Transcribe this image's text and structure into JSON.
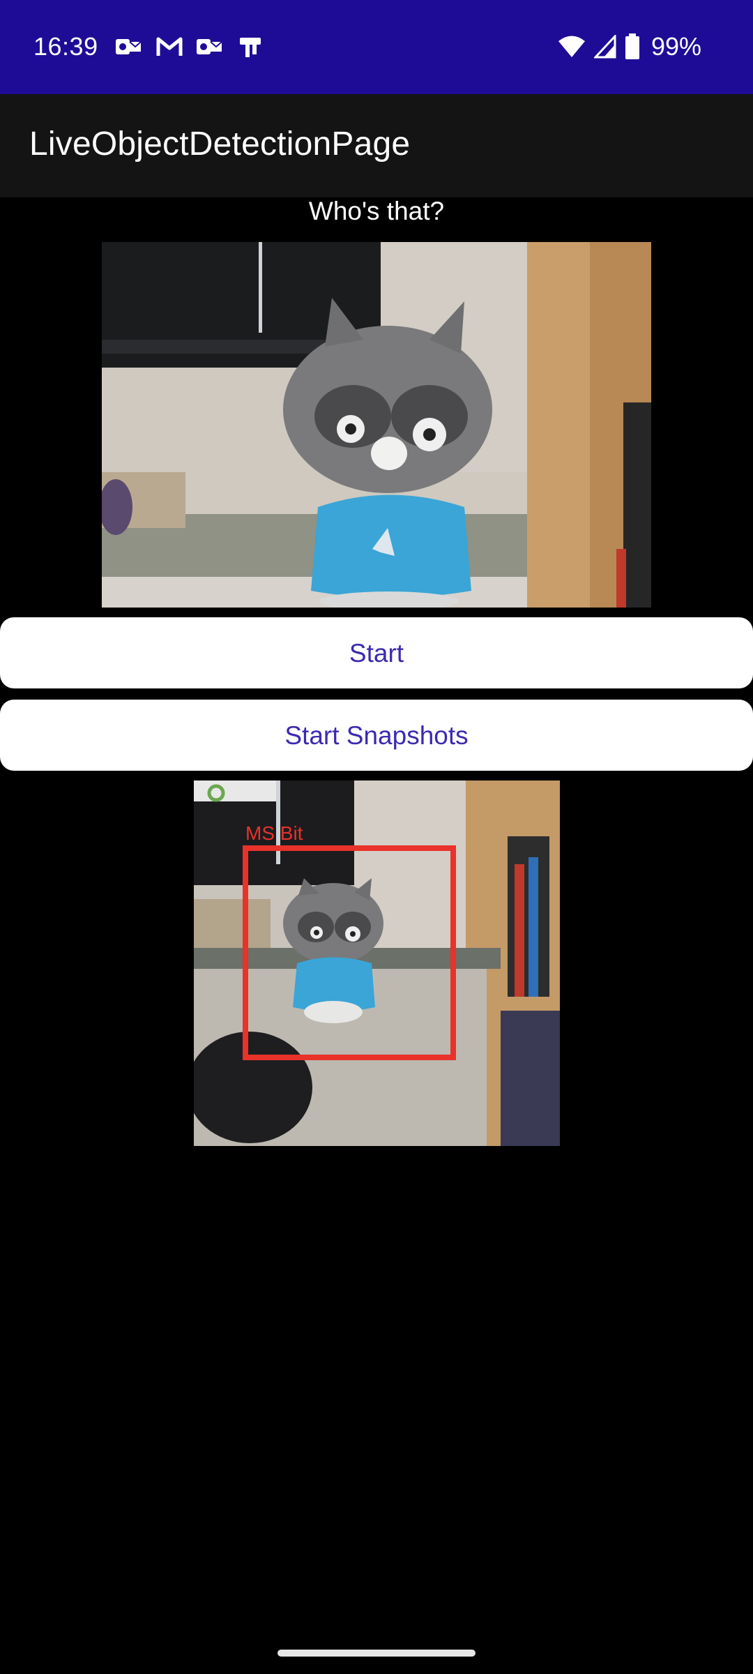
{
  "status_bar": {
    "time": "16:39",
    "notification_icons": [
      "outlook-icon",
      "gmail-icon",
      "outlook-icon",
      "teams-icon"
    ],
    "system_icons": [
      "wifi-icon",
      "cellular-signal-icon",
      "battery-icon"
    ],
    "battery_percent": "99%",
    "background_color": "#1f0c96"
  },
  "app_bar": {
    "title": "LiveObjectDetectionPage",
    "background_color": "#141414"
  },
  "main": {
    "subtitle": "Who's that?",
    "buttons": {
      "start_label": "Start",
      "start_snapshots_label": "Start Snapshots",
      "text_color": "#3b2ab0"
    },
    "detection": {
      "label": "MS Bit",
      "box_color": "#e8322a"
    }
  }
}
